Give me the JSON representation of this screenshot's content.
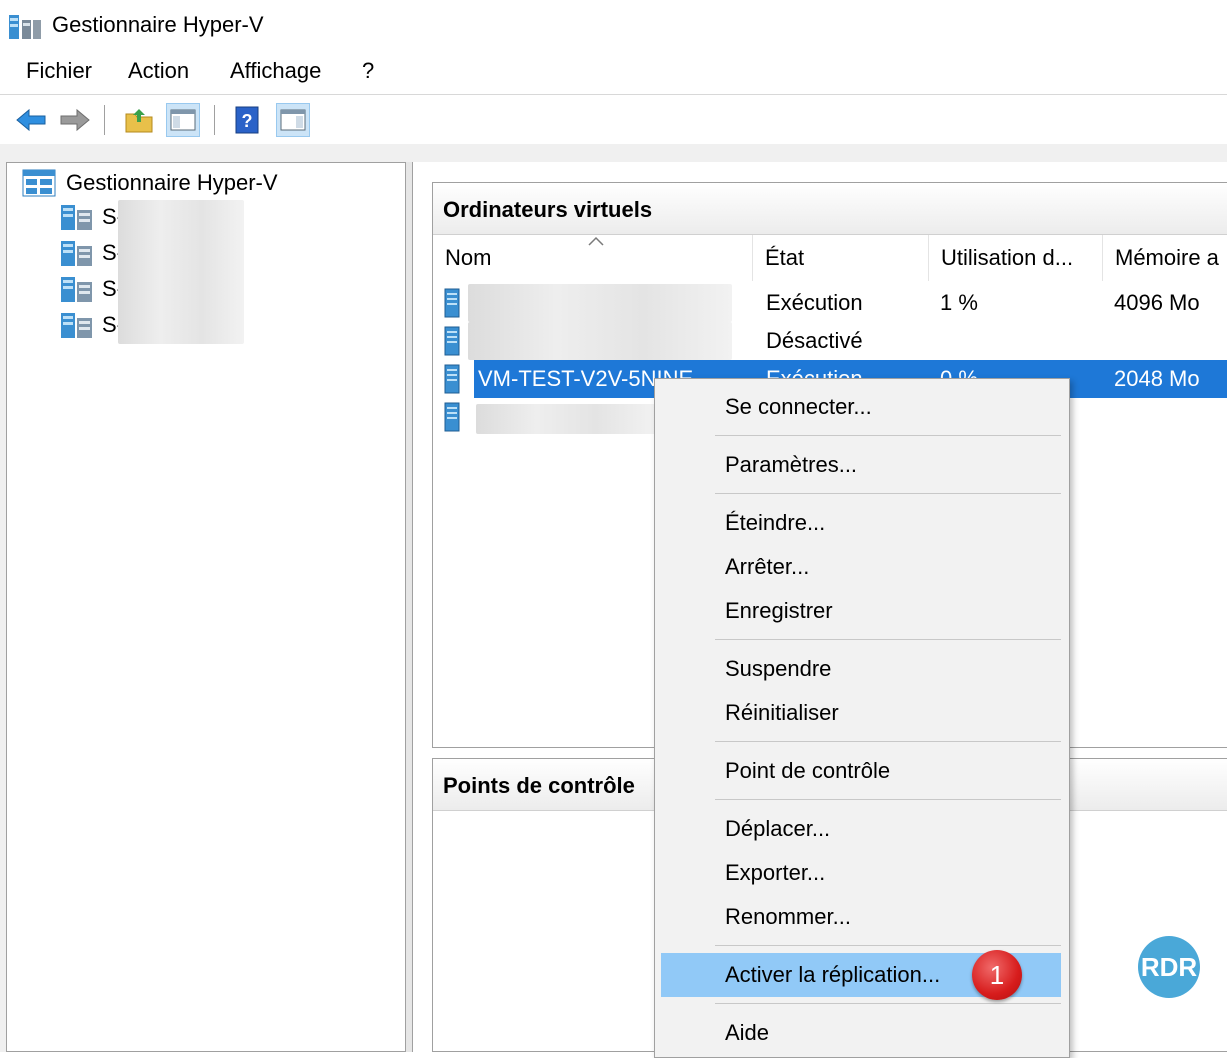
{
  "window": {
    "title": "Gestionnaire Hyper-V"
  },
  "menu": [
    {
      "label": "Fichier"
    },
    {
      "label": "Action"
    },
    {
      "label": "Affichage"
    },
    {
      "label": "?"
    }
  ],
  "tree": {
    "root": "Gestionnaire Hyper-V",
    "servers": [
      {
        "label": "S-"
      },
      {
        "label": "S-"
      },
      {
        "label": "S-"
      },
      {
        "label": "S-"
      }
    ]
  },
  "vm_panel": {
    "title": "Ordinateurs virtuels",
    "columns": [
      "Nom",
      "État",
      "Utilisation d...",
      "Mémoire a"
    ],
    "rows": [
      {
        "name": "",
        "state": "Exécution",
        "cpu": "1 %",
        "memory": "4096 Mo"
      },
      {
        "name": "",
        "state": "Désactivé",
        "cpu": "",
        "memory": ""
      },
      {
        "name": "VM-TEST-V2V-5NINE",
        "state": "Exécution",
        "cpu": "0 %",
        "memory": "2048 Mo"
      },
      {
        "name": "",
        "state": "",
        "cpu": "",
        "memory": ""
      }
    ]
  },
  "checkpoint_panel": {
    "title": "Points de contrôle"
  },
  "context_menu": {
    "items": [
      "Se connecter...",
      "Paramètres...",
      "Éteindre...",
      "Arrêter...",
      "Enregistrer",
      "Suspendre",
      "Réinitialiser",
      "Point de contrôle",
      "Déplacer...",
      "Exporter...",
      "Renommer...",
      "Activer la réplication...",
      "Aide"
    ],
    "highlighted": "Activer la réplication..."
  },
  "annotation": {
    "badge": "1",
    "logo": "RDR"
  },
  "colors": {
    "selection": "#1e78d7",
    "highlight": "#91c9f7",
    "badge": "#d71c1c"
  }
}
